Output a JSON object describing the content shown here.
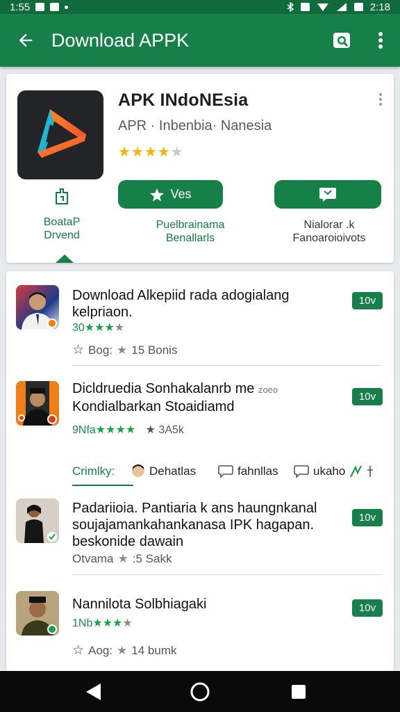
{
  "status": {
    "time": "1:55",
    "clock": "2:18"
  },
  "appbar": {
    "title": "Download APPK"
  },
  "app": {
    "name": "APK INdoNEsia",
    "subtitle": "APR · Inbenbia· Nanesia",
    "rating_stars": 4,
    "buttons": {
      "primary": "Ves"
    },
    "tabs": [
      {
        "label1": "BoataP",
        "label2": "Drvend"
      },
      {
        "label1": "Puelbrainama",
        "label2": "Benallarls"
      },
      {
        "label1": "Nialorar .k",
        "label2": "Fanoaroioivots"
      }
    ]
  },
  "items": [
    {
      "title": "Download Alkepiid rada adogialang kelpriaon.",
      "rating_label": "30",
      "meta_label": "Bog:",
      "meta_value": "15 Bonis",
      "badge": "10v"
    },
    {
      "title": "Dicldruedia Sonhakalanrb me",
      "title_small": "zoeo",
      "title2": "Kondialbarkan Stoaidiamd",
      "rating_label": "9Nfa",
      "meta_value": "3A5k",
      "badge": "10v"
    },
    {
      "title": "Padariioia. Pantiaria k ans haungnkanal soujajamankahankanasa IPK hagapan. beskonide dawain",
      "meta_label": "Otvama",
      "meta_value": ":5 Sakk",
      "badge": "10v"
    },
    {
      "title": "Nannilota Solbhiagaki",
      "rating_label": "1Nb",
      "meta_label": "Aog:",
      "meta_value": "14 bumk",
      "badge": "10v"
    }
  ],
  "filters": {
    "f1": "Crimlky:",
    "f2": "Dehatlas",
    "f3": "fahnllas",
    "f4": "ukaho"
  },
  "colors": {
    "brand_green": "#17804a",
    "status_green": "#0f6b3b",
    "star_gold": "#f5b400"
  }
}
